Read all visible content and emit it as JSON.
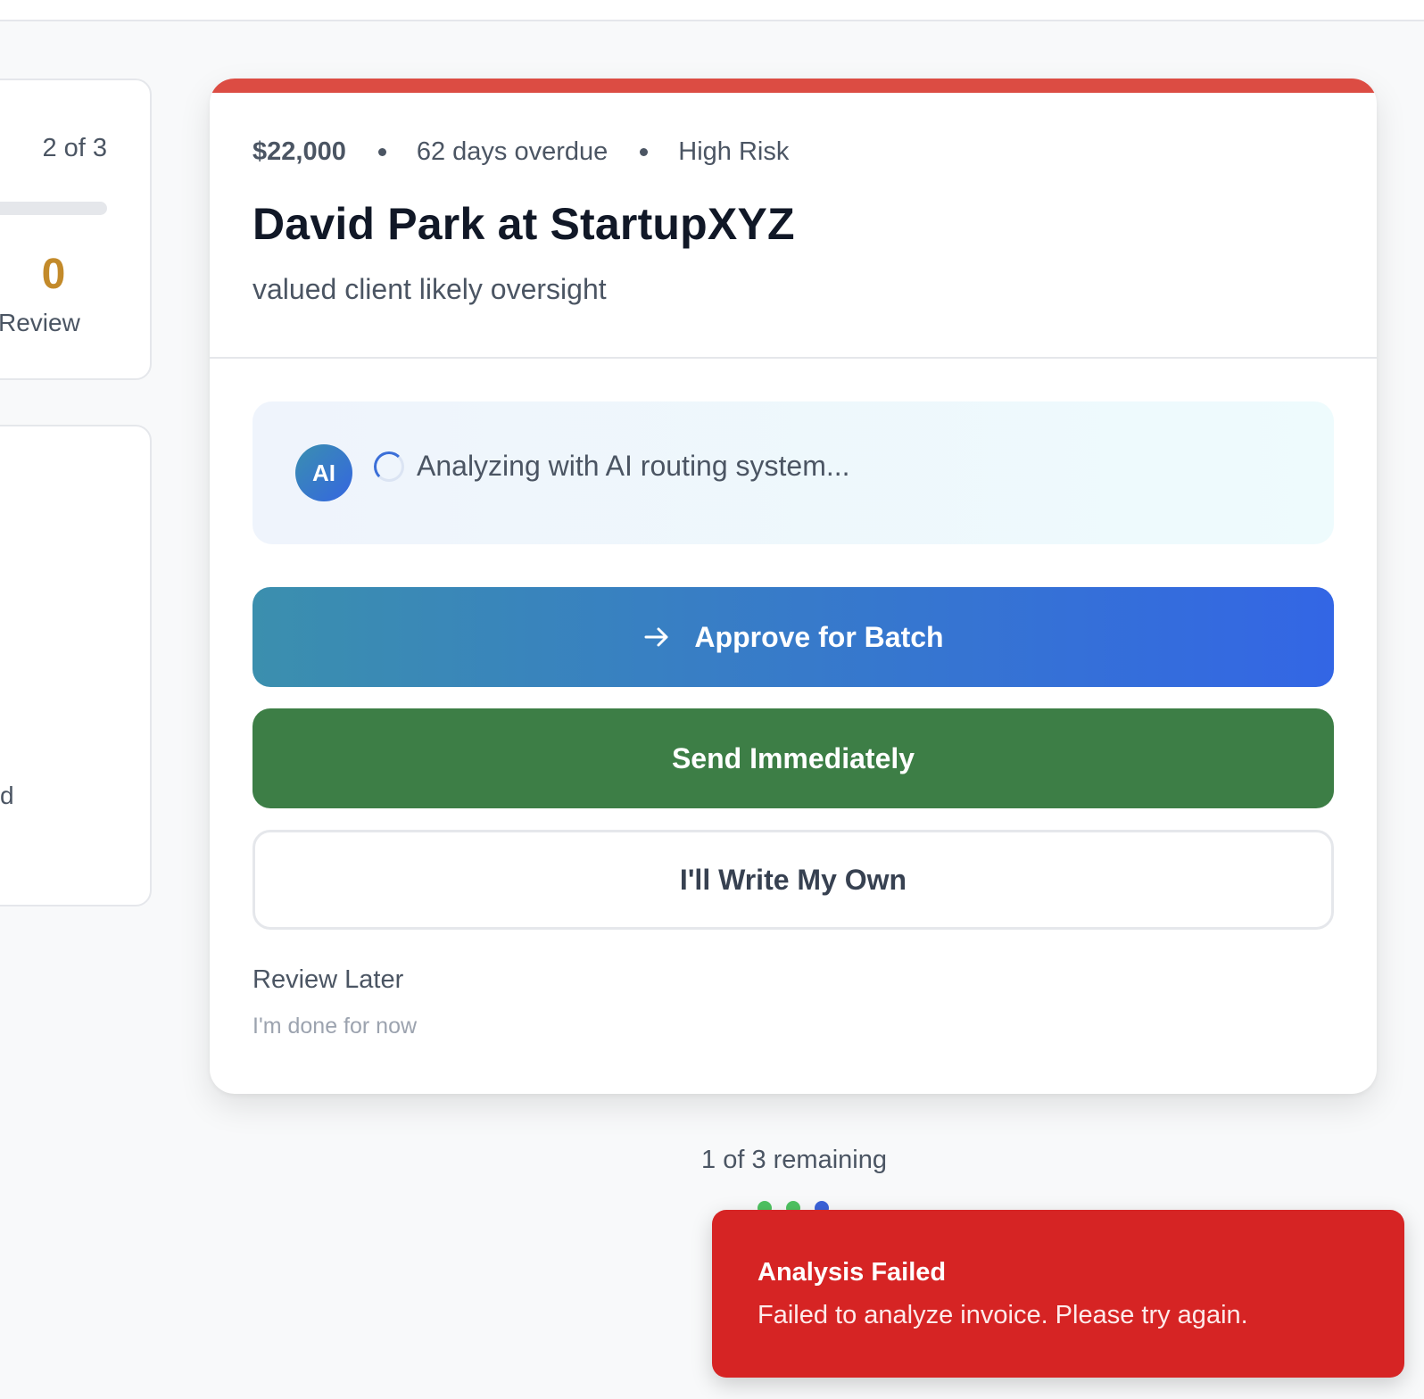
{
  "side": {
    "progress_text": "2 of 3",
    "review_count": "0",
    "review_label": "Review",
    "partial_text": "d"
  },
  "invoice": {
    "amount": "$22,000",
    "overdue": "62 days overdue",
    "risk": "High Risk",
    "risk_color": "#dc4c43",
    "client": "David Park at StartupXYZ",
    "subtitle": "valued client likely oversight"
  },
  "ai": {
    "avatar_label": "AI",
    "status": "Analyzing with AI routing system..."
  },
  "actions": {
    "approve_label": "Approve for Batch",
    "approve_icon": "arrow-right-icon",
    "send_label": "Send Immediately",
    "write_label": "I'll Write My Own",
    "review_later": "Review Later",
    "done_for_now": "I'm done for now"
  },
  "queue": {
    "remaining": "1 of 3 remaining",
    "dots": [
      "#4ec261",
      "#4ec261",
      "#3b62d8"
    ]
  },
  "toast": {
    "title": "Analysis Failed",
    "message": "Failed to analyze invoice. Please try again.",
    "color": "#d62424"
  }
}
